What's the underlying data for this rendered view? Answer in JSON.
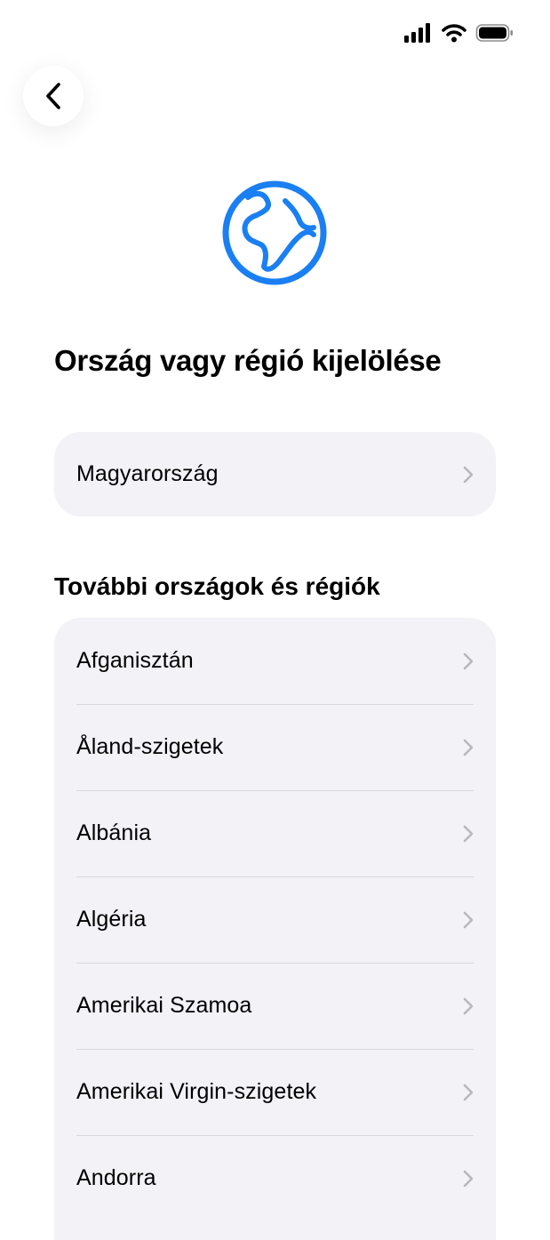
{
  "status_bar": {
    "icons": [
      "signal-icon",
      "wifi-icon",
      "battery-icon"
    ]
  },
  "nav": {
    "back_icon": "chevron-left-icon"
  },
  "hero": {
    "icon": "globe-icon",
    "accent_color": "#1a7ff2"
  },
  "title": "Ország vagy régió kijelölése",
  "selected": {
    "label": "Magyarország"
  },
  "more_section": {
    "title": "További országok és régiók",
    "items": [
      {
        "label": "Afganisztán"
      },
      {
        "label": "Åland-szigetek"
      },
      {
        "label": "Albánia"
      },
      {
        "label": "Algéria"
      },
      {
        "label": "Amerikai Szamoa"
      },
      {
        "label": "Amerikai Virgin-szigetek"
      },
      {
        "label": "Andorra"
      }
    ]
  },
  "colors": {
    "card_background": "#f2f2f7",
    "chevron": "#b9b9bd",
    "separator": "#d8d8dc"
  }
}
